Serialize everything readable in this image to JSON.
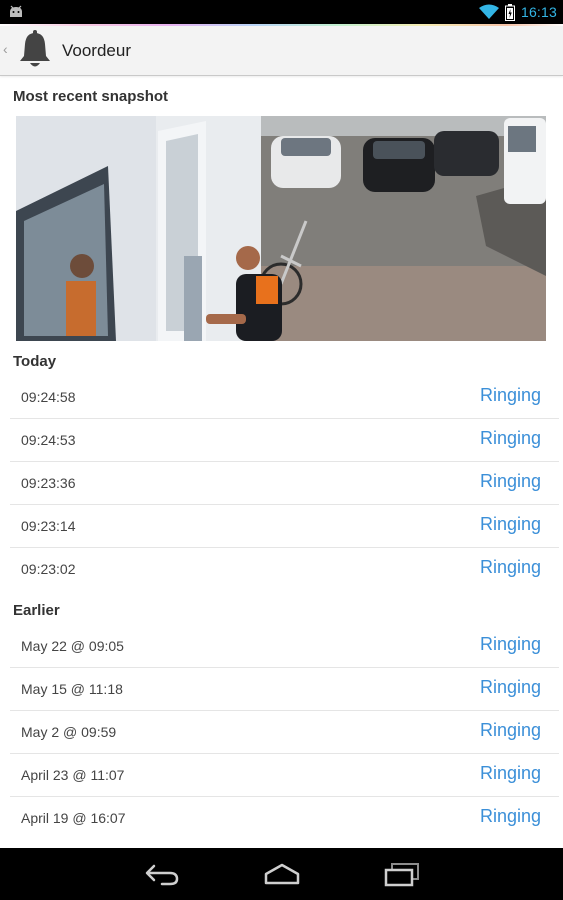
{
  "status_bar": {
    "time": "16:13",
    "icons": [
      "android-notification-icon",
      "wifi-icon",
      "battery-icon"
    ]
  },
  "action_bar": {
    "title": "Voordeur",
    "icon": "bell-icon"
  },
  "snapshot_section": {
    "header": "Most recent snapshot"
  },
  "today": {
    "header": "Today",
    "items": [
      {
        "time": "09:24:58",
        "status": "Ringing"
      },
      {
        "time": "09:24:53",
        "status": "Ringing"
      },
      {
        "time": "09:23:36",
        "status": "Ringing"
      },
      {
        "time": "09:23:14",
        "status": "Ringing"
      },
      {
        "time": "09:23:02",
        "status": "Ringing"
      }
    ]
  },
  "earlier": {
    "header": "Earlier",
    "items": [
      {
        "time": "May 22 @ 09:05",
        "status": "Ringing"
      },
      {
        "time": "May 15 @ 11:18",
        "status": "Ringing"
      },
      {
        "time": "May 2 @ 09:59",
        "status": "Ringing"
      },
      {
        "time": "April 23 @ 11:07",
        "status": "Ringing"
      },
      {
        "time": "April 19 @ 16:07",
        "status": "Ringing"
      }
    ]
  },
  "nav_bar": {
    "buttons": [
      "back-icon",
      "home-icon",
      "recent-apps-icon"
    ]
  },
  "colors": {
    "accent": "#3b8fd8",
    "status_time": "#33b5e5",
    "action_bar_bg": "#f3f3f3"
  }
}
